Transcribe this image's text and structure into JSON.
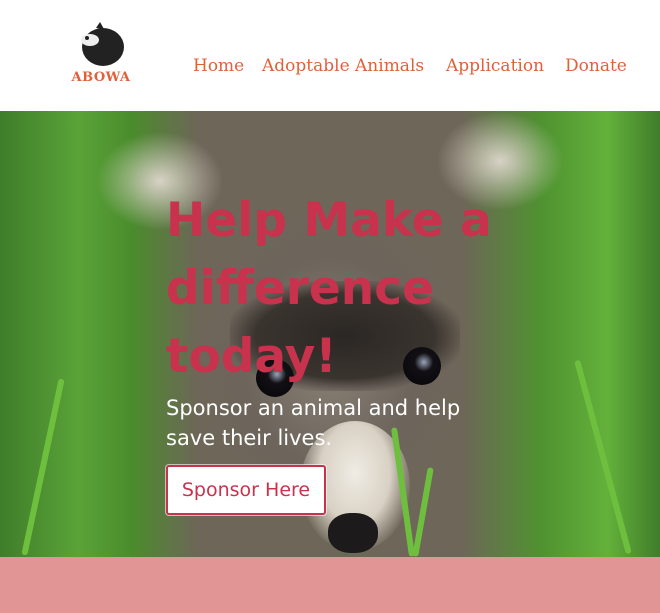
{
  "header": {
    "logo_text": "ABOWA",
    "nav": {
      "home": "Home",
      "adoptable_animals": "Adoptable Animals",
      "application": "Application",
      "donate": "Donate"
    }
  },
  "hero": {
    "title_line1": "Help Make a",
    "title_line2": "difference",
    "title_line3": "today!",
    "subtitle": "Sponsor an animal and help save their lives.",
    "button_label": "Sponsor Here"
  },
  "colors": {
    "accent": "#c8324d",
    "nav": "#e0603a",
    "band": "#e29595"
  },
  "icons": {
    "logo": "sleeping-animal-logo-icon"
  }
}
